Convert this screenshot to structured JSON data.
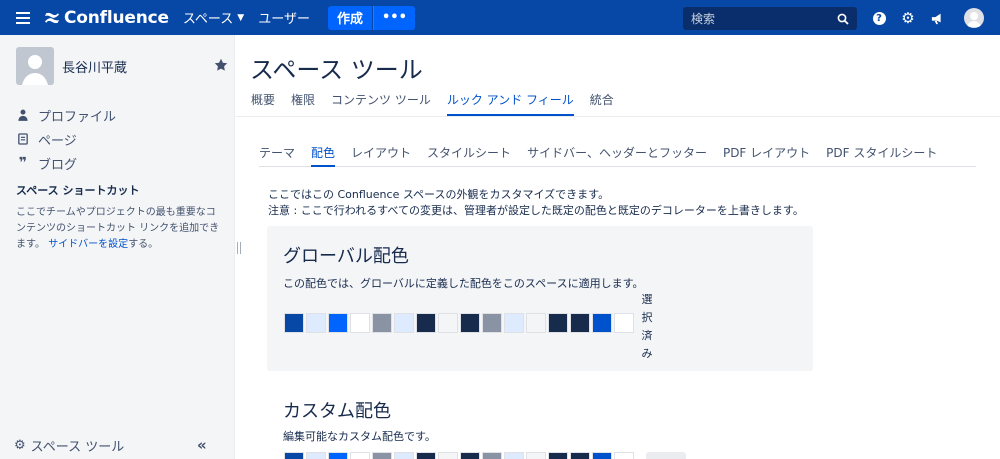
{
  "topbar": {
    "app_name": "Confluence",
    "nav_spaces": "スペース",
    "nav_users": "ユーザー",
    "create_label": "作成",
    "more_label": "•••",
    "search_placeholder": "検索"
  },
  "sidebar": {
    "user_name": "長谷川平蔵",
    "items": [
      {
        "label": "プロファイル",
        "icon": "person-icon"
      },
      {
        "label": "ページ",
        "icon": "page-icon"
      },
      {
        "label": "ブログ",
        "icon": "quote-icon"
      }
    ],
    "shortcut_title": "スペース ショートカット",
    "shortcut_desc": "ここでチームやプロジェクトの最も重要なコンテンツのショートカット リンクを追加できます。",
    "shortcut_link": "サイドバーを設定",
    "shortcut_tail": "する。",
    "space_tools": "スペース ツール",
    "collapse_label": "«"
  },
  "main": {
    "title": "スペース ツール",
    "tabs": [
      "概要",
      "権限",
      "コンテンツ ツール",
      "ルック アンド フィール",
      "統合"
    ],
    "active_tab": 3,
    "sub_tabs": [
      "テーマ",
      "配色",
      "レイアウト",
      "スタイルシート",
      "サイドバー、ヘッダーとフッター",
      "PDF レイアウト",
      "PDF スタイルシート"
    ],
    "active_sub_tab": 1,
    "intro_line1": "ここではこの Confluence スペースの外観をカスタマイズできます。",
    "intro_line2": "注意 : ここで行われるすべての変更は、管理者が設定した既定の配色と既定のデコレーターを上書きします。",
    "global_scheme": {
      "title": "グローバル配色",
      "desc": "この配色では、グローバルに定義した配色をこのスペースに適用します。",
      "selected_label": "選択済み",
      "swatches": [
        "#0747a6",
        "#deebff",
        "#0065ff",
        "#ffffff",
        "#8993a4",
        "#deebff",
        "#172b4d",
        "#f4f5f7",
        "#172b4d",
        "#8993a4",
        "#deebff",
        "#f4f5f7",
        "#172b4d",
        "#172b4d",
        "#0052cc",
        "#ffffff"
      ]
    },
    "custom_scheme": {
      "title": "カスタム配色",
      "desc": "編集可能なカスタム配色です。",
      "swatches": [
        "#0747a6",
        "#deebff",
        "#0065ff",
        "#ffffff",
        "#8993a4",
        "#deebff",
        "#172b4d",
        "#f4f5f7",
        "#172b4d",
        "#8993a4",
        "#deebff",
        "#f4f5f7",
        "#172b4d",
        "#172b4d",
        "#0052cc",
        "#ffffff"
      ]
    }
  },
  "colors": {
    "topbar": "#0747a6",
    "accent": "#0052cc"
  }
}
